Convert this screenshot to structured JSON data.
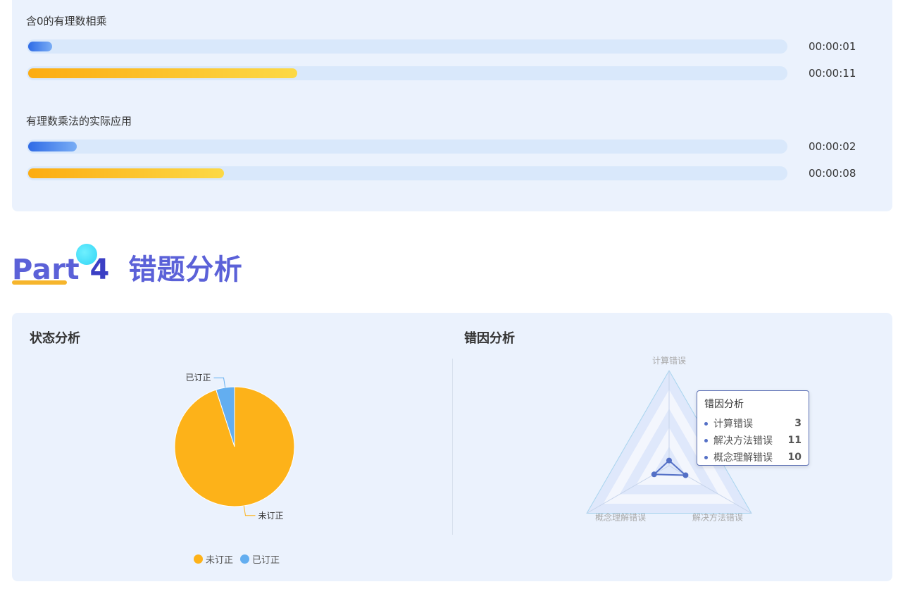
{
  "time_groups": [
    {
      "title": "含0的有理数相乘",
      "bars": [
        {
          "color": "blue",
          "fraction": 0.032,
          "time": "00:00:01"
        },
        {
          "color": "yellow",
          "fraction": 0.355,
          "time": "00:00:11"
        }
      ]
    },
    {
      "title": "有理数乘法的实际应用",
      "bars": [
        {
          "color": "blue",
          "fraction": 0.064,
          "time": "00:00:02"
        },
        {
          "color": "yellow",
          "fraction": 0.258,
          "time": "00:00:08"
        }
      ]
    }
  ],
  "part": {
    "label": "Part",
    "number": "4",
    "title": "错题分析"
  },
  "status_section": {
    "title": "状态分析"
  },
  "cause_section": {
    "title": "错因分析"
  },
  "chart_data": [
    {
      "type": "pie",
      "title": "",
      "slices": [
        {
          "name": "未订正",
          "value": 95,
          "color": "#fdb219"
        },
        {
          "name": "已订正",
          "value": 5,
          "color": "#63aef0"
        }
      ],
      "legend": [
        "未订正",
        "已订正"
      ],
      "legend_placement": "bottom"
    },
    {
      "type": "radar",
      "title": "",
      "indicators": [
        "计算错误",
        "解决方法错误",
        "概念理解错误"
      ],
      "max": 55,
      "series": [
        {
          "name": "错因分析",
          "values": [
            3,
            11,
            10
          ],
          "color": "#5470c6"
        }
      ],
      "tooltip": {
        "title": "错因分析",
        "rows": [
          {
            "name": "计算错误",
            "value": "3"
          },
          {
            "name": "解决方法错误",
            "value": "11"
          },
          {
            "name": "概念理解错误",
            "value": "10"
          }
        ]
      }
    }
  ]
}
